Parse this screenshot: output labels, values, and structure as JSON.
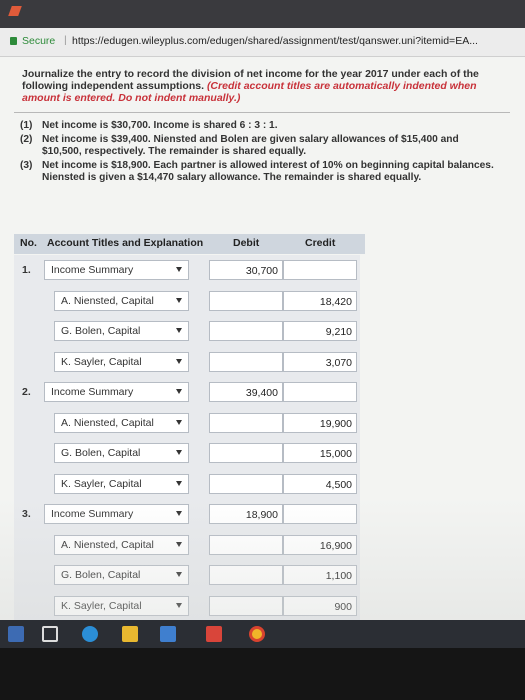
{
  "browser": {
    "secure_label": "Secure",
    "url": "https://edugen.wileyplus.com/edugen/shared/assignment/test/qanswer.uni?itemid=EA..."
  },
  "instructions": {
    "line1": "Journalize the entry to record the division of net income for the year 2017 under each of the following independent assumptions.",
    "credit_note": "(Credit account titles are automatically indented when amount is entered. Do not indent manually.)"
  },
  "assumptions": [
    {
      "num": "(1)",
      "text": "Net income is $30,700. Income is shared 6 : 3 : 1."
    },
    {
      "num": "(2)",
      "text": "Net income is $39,400. Niensted and Bolen are given salary allowances of $15,400 and $10,500, respectively. The remainder is shared equally."
    },
    {
      "num": "(3)",
      "text": "Net income is $18,900. Each partner is allowed interest of 10% on beginning capital balances. Niensted is given a $14,470 salary allowance. The remainder is shared equally."
    }
  ],
  "table": {
    "headers": {
      "no": "No.",
      "account": "Account Titles and Explanation",
      "debit": "Debit",
      "credit": "Credit"
    },
    "entries": [
      {
        "no": "1.",
        "lines": [
          {
            "account": "Income Summary",
            "debit": "30,700",
            "credit": ""
          },
          {
            "account": "A. Niensted, Capital",
            "debit": "",
            "credit": "18,420"
          },
          {
            "account": "G. Bolen, Capital",
            "debit": "",
            "credit": "9,210"
          },
          {
            "account": "K. Sayler, Capital",
            "debit": "",
            "credit": "3,070"
          }
        ]
      },
      {
        "no": "2.",
        "lines": [
          {
            "account": "Income Summary",
            "debit": "39,400",
            "credit": ""
          },
          {
            "account": "A. Niensted, Capital",
            "debit": "",
            "credit": "19,900"
          },
          {
            "account": "G. Bolen, Capital",
            "debit": "",
            "credit": "15,000"
          },
          {
            "account": "K. Sayler, Capital",
            "debit": "",
            "credit": "4,500"
          }
        ]
      },
      {
        "no": "3.",
        "lines": [
          {
            "account": "Income Summary",
            "debit": "18,900",
            "credit": ""
          },
          {
            "account": "A. Niensted, Capital",
            "debit": "",
            "credit": "16,900"
          },
          {
            "account": "G. Bolen, Capital",
            "debit": "",
            "credit": "1,100"
          },
          {
            "account": "K. Sayler, Capital",
            "debit": "",
            "credit": "900"
          }
        ]
      }
    ]
  },
  "taskbar": {
    "icons": [
      "windows-icon",
      "task-view-icon",
      "edge-icon",
      "file-explorer-icon",
      "store-icon",
      "office-icon",
      "chrome-icon"
    ]
  },
  "colors": {
    "accent_red": "#c8323a",
    "header_bg": "#cfd6de",
    "secure_green": "#2e8b3a"
  }
}
